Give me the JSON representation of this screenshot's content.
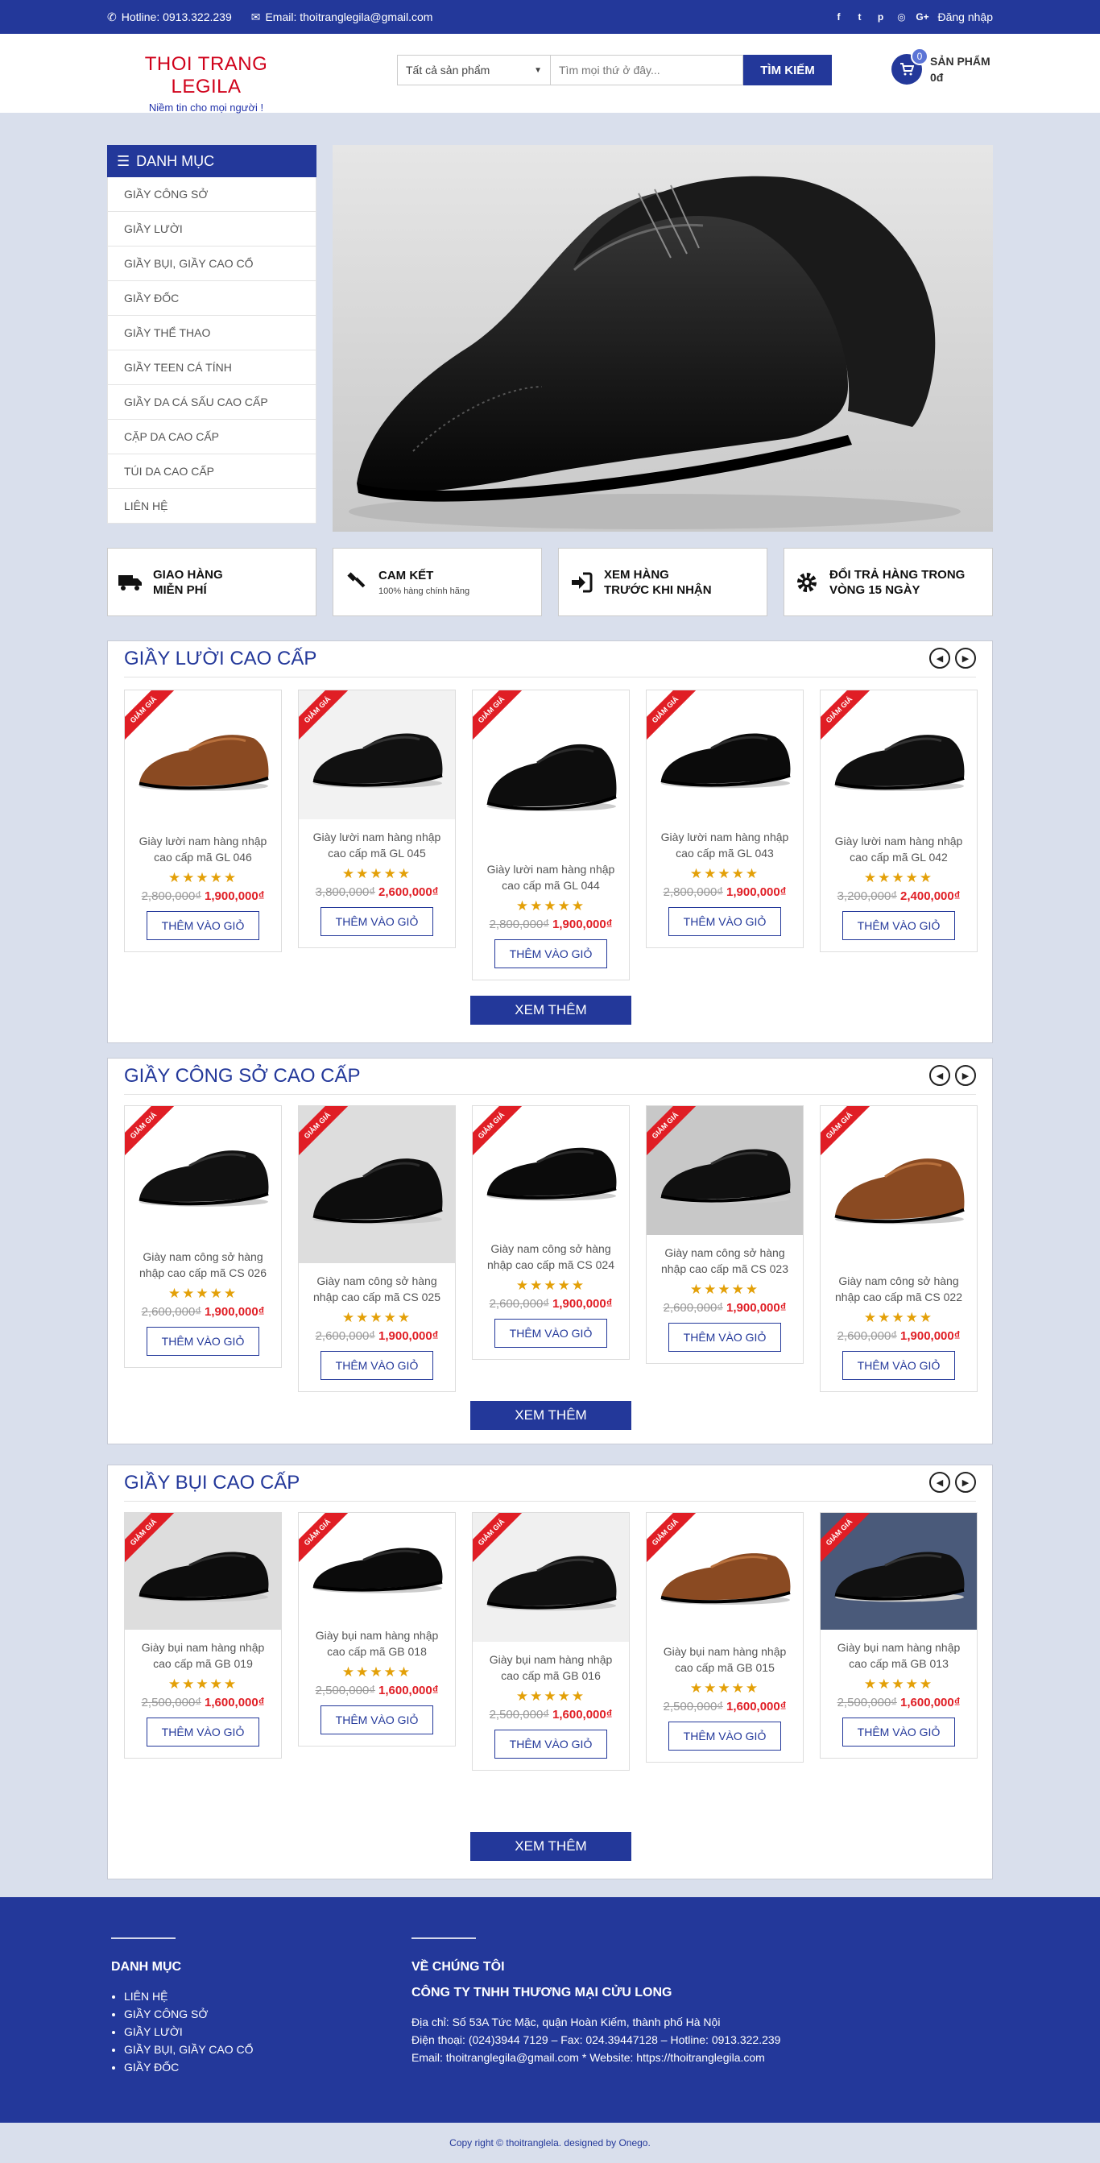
{
  "topbar": {
    "hotline": "Hotline: 0913.322.239",
    "email": "Email: thoitranglegila@gmail.com",
    "login": "Đăng nhập"
  },
  "header": {
    "logo_title": "THOI TRANG LEGILA",
    "logo_slogan": "Niềm tin cho mọi người !",
    "search_category": "Tất cả sản phẩm",
    "search_placeholder": "Tìm mọi thứ ở đây...",
    "search_button": "TÌM KIẾM",
    "cart_count": "0",
    "cart_label": "SẢN PHẨM",
    "cart_total": "0đ"
  },
  "sidebar": {
    "title": "DANH MỤC",
    "items": [
      "GIẦY CÔNG SỞ",
      "GIẦY LƯỜI",
      "GIẦY BỤI, GIẦY CAO CỔ",
      "GIẦY ĐỐC",
      "GIẦY THỂ THAO",
      "GIẦY TEEN CÁ TÍNH",
      "GIẦY DA CÁ SẤU CAO CẤP",
      "CẶP DA CAO CẤP",
      "TÚI DA CAO CẤP",
      "LIÊN HỆ"
    ]
  },
  "features": [
    {
      "title1": "GIAO HÀNG",
      "title2": "MIỄN PHÍ",
      "sub": "",
      "icon": "truck-icon"
    },
    {
      "title1": "CAM KẾT",
      "title2": "",
      "sub": "100% hàng chính hãng",
      "icon": "gavel-icon"
    },
    {
      "title1": "XEM HÀNG",
      "title2": "TRƯỚC KHI NHẬN",
      "sub": "",
      "icon": "sign-in-icon"
    },
    {
      "title1": "ĐỔI TRẢ HÀNG TRONG",
      "title2": "VÒNG 15 NGÀY",
      "sub": "",
      "icon": "gear-icon"
    }
  ],
  "ribbon": "GIẢM GIÁ",
  "add_to_cart": "THÊM VÀO GIỎ",
  "stars": "★★★★★",
  "more_label": "XEM THÊM",
  "sections": [
    {
      "title": "GIẦY LƯỜI CAO CẤP",
      "products": [
        {
          "name1": "Giày lười nam hàng nhập",
          "name2": "cao cấp mã GL 046",
          "old": "2,800,000₫",
          "new": "1,900,000₫"
        },
        {
          "name1": "Giày lười nam hàng nhập",
          "name2": "cao cấp mã GL 045",
          "old": "3,800,000₫",
          "new": "2,600,000₫"
        },
        {
          "name1": "Giày lười nam hàng nhập",
          "name2": "cao cấp mã GL 044",
          "old": "2,800,000₫",
          "new": "1,900,000₫"
        },
        {
          "name1": "Giày lười nam hàng nhập",
          "name2": "cao cấp mã GL 043",
          "old": "2,800,000₫",
          "new": "1,900,000₫"
        },
        {
          "name1": "Giày lười nam hàng nhập",
          "name2": "cao cấp mã GL 042",
          "old": "3,200,000₫",
          "new": "2,400,000₫"
        }
      ]
    },
    {
      "title": "GIẦY CÔNG SỞ CAO CẤP",
      "products": [
        {
          "name1": "Giày nam công sở hàng",
          "name2": "nhập cao cấp mã CS 026",
          "old": "2,600,000₫",
          "new": "1,900,000₫"
        },
        {
          "name1": "Giày nam công sở hàng",
          "name2": "nhập cao cấp mã CS 025",
          "old": "2,600,000₫",
          "new": "1,900,000₫"
        },
        {
          "name1": "Giày nam công sở hàng",
          "name2": "nhập cao cấp mã CS 024",
          "old": "2,600,000₫",
          "new": "1,900,000₫"
        },
        {
          "name1": "Giày nam công sở hàng",
          "name2": "nhập cao cấp mã CS 023",
          "old": "2,600,000₫",
          "new": "1,900,000₫"
        },
        {
          "name1": "Giày nam công sở hàng",
          "name2": "nhập cao cấp mã CS 022",
          "old": "2,600,000₫",
          "new": "1,900,000₫"
        }
      ]
    },
    {
      "title": "GIẦY BỤI CAO CẤP",
      "products": [
        {
          "name1": "Giày bụi nam hàng nhập",
          "name2": "cao cấp mã GB 019",
          "old": "2,500,000₫",
          "new": "1,600,000₫"
        },
        {
          "name1": "Giày bụi nam hàng nhập",
          "name2": "cao cấp mã GB 018",
          "old": "2,500,000₫",
          "new": "1,600,000₫"
        },
        {
          "name1": "Giày bụi nam hàng nhập",
          "name2": "cao cấp mã GB 016",
          "old": "2,500,000₫",
          "new": "1,600,000₫"
        },
        {
          "name1": "Giày bụi nam hàng nhập",
          "name2": "cao cấp mã GB 015",
          "old": "2,500,000₫",
          "new": "1,600,000₫"
        },
        {
          "name1": "Giày bụi nam hàng nhập",
          "name2": "cao cấp mã GB 013",
          "old": "2,500,000₫",
          "new": "1,600,000₫"
        }
      ]
    }
  ],
  "footer": {
    "cat_title": "DANH MỤC",
    "cat_items": [
      "LIÊN HỆ",
      "GIẦY CÔNG SỞ",
      "GIẦY LƯỜI",
      "GIẦY BỤI, GIẦY CAO CỔ",
      "GIẦY ĐỐC"
    ],
    "about_title": "VỀ CHÚNG TÔI",
    "company": "CÔNG TY TNHH THƯƠNG MẠI CỬU LONG",
    "address": "Địa chỉ: Số 53A Tức Mặc, quận Hoàn Kiếm, thành phố Hà Nội",
    "phone": "Điện thoại: (024)3944 7129 – Fax: 024.39447128 – Hotline: 0913.322.239",
    "email": "Email: thoitranglegila@gmail.com * Website: https://thoitranglegila.com",
    "copyright": "Copy right © thoitranglela. designed by Onego."
  }
}
